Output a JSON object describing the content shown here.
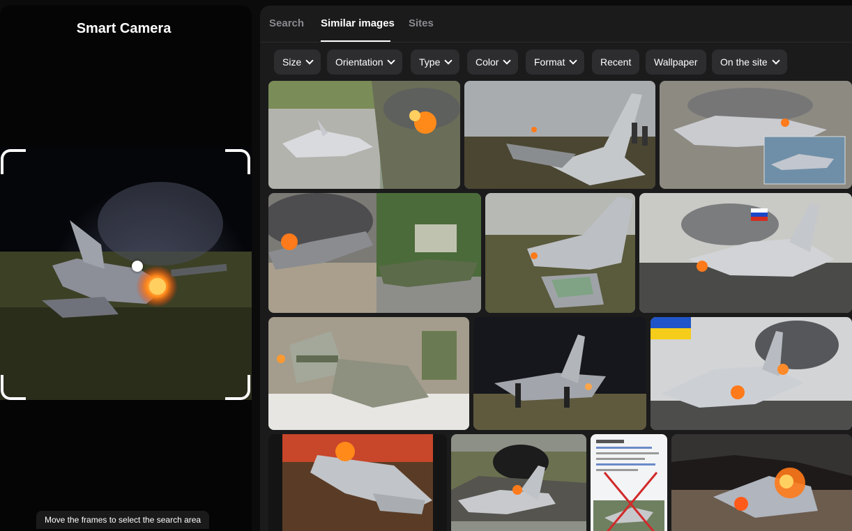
{
  "left_panel": {
    "title": "Smart Camera",
    "hint": "Move the frames to select the search area"
  },
  "tabs": [
    {
      "label": "Search",
      "active": false
    },
    {
      "label": "Similar images",
      "active": true
    },
    {
      "label": "Sites",
      "active": false
    }
  ],
  "filters": [
    {
      "label": "Size",
      "dropdown": true
    },
    {
      "label": "Orientation",
      "dropdown": true
    },
    {
      "label": "Type",
      "dropdown": true
    },
    {
      "label": "Color",
      "dropdown": true
    },
    {
      "label": "Format",
      "dropdown": true
    },
    {
      "label": "Recent",
      "dropdown": false
    },
    {
      "label": "Wallpaper",
      "dropdown": false
    },
    {
      "label": "On the site",
      "dropdown": true
    }
  ],
  "colors": {
    "background": "#0b0b0c",
    "panel": "#1b1b1c",
    "chip": "#2d2d30",
    "text_muted": "#8a8a8e",
    "fire": "#ff7a1a"
  }
}
